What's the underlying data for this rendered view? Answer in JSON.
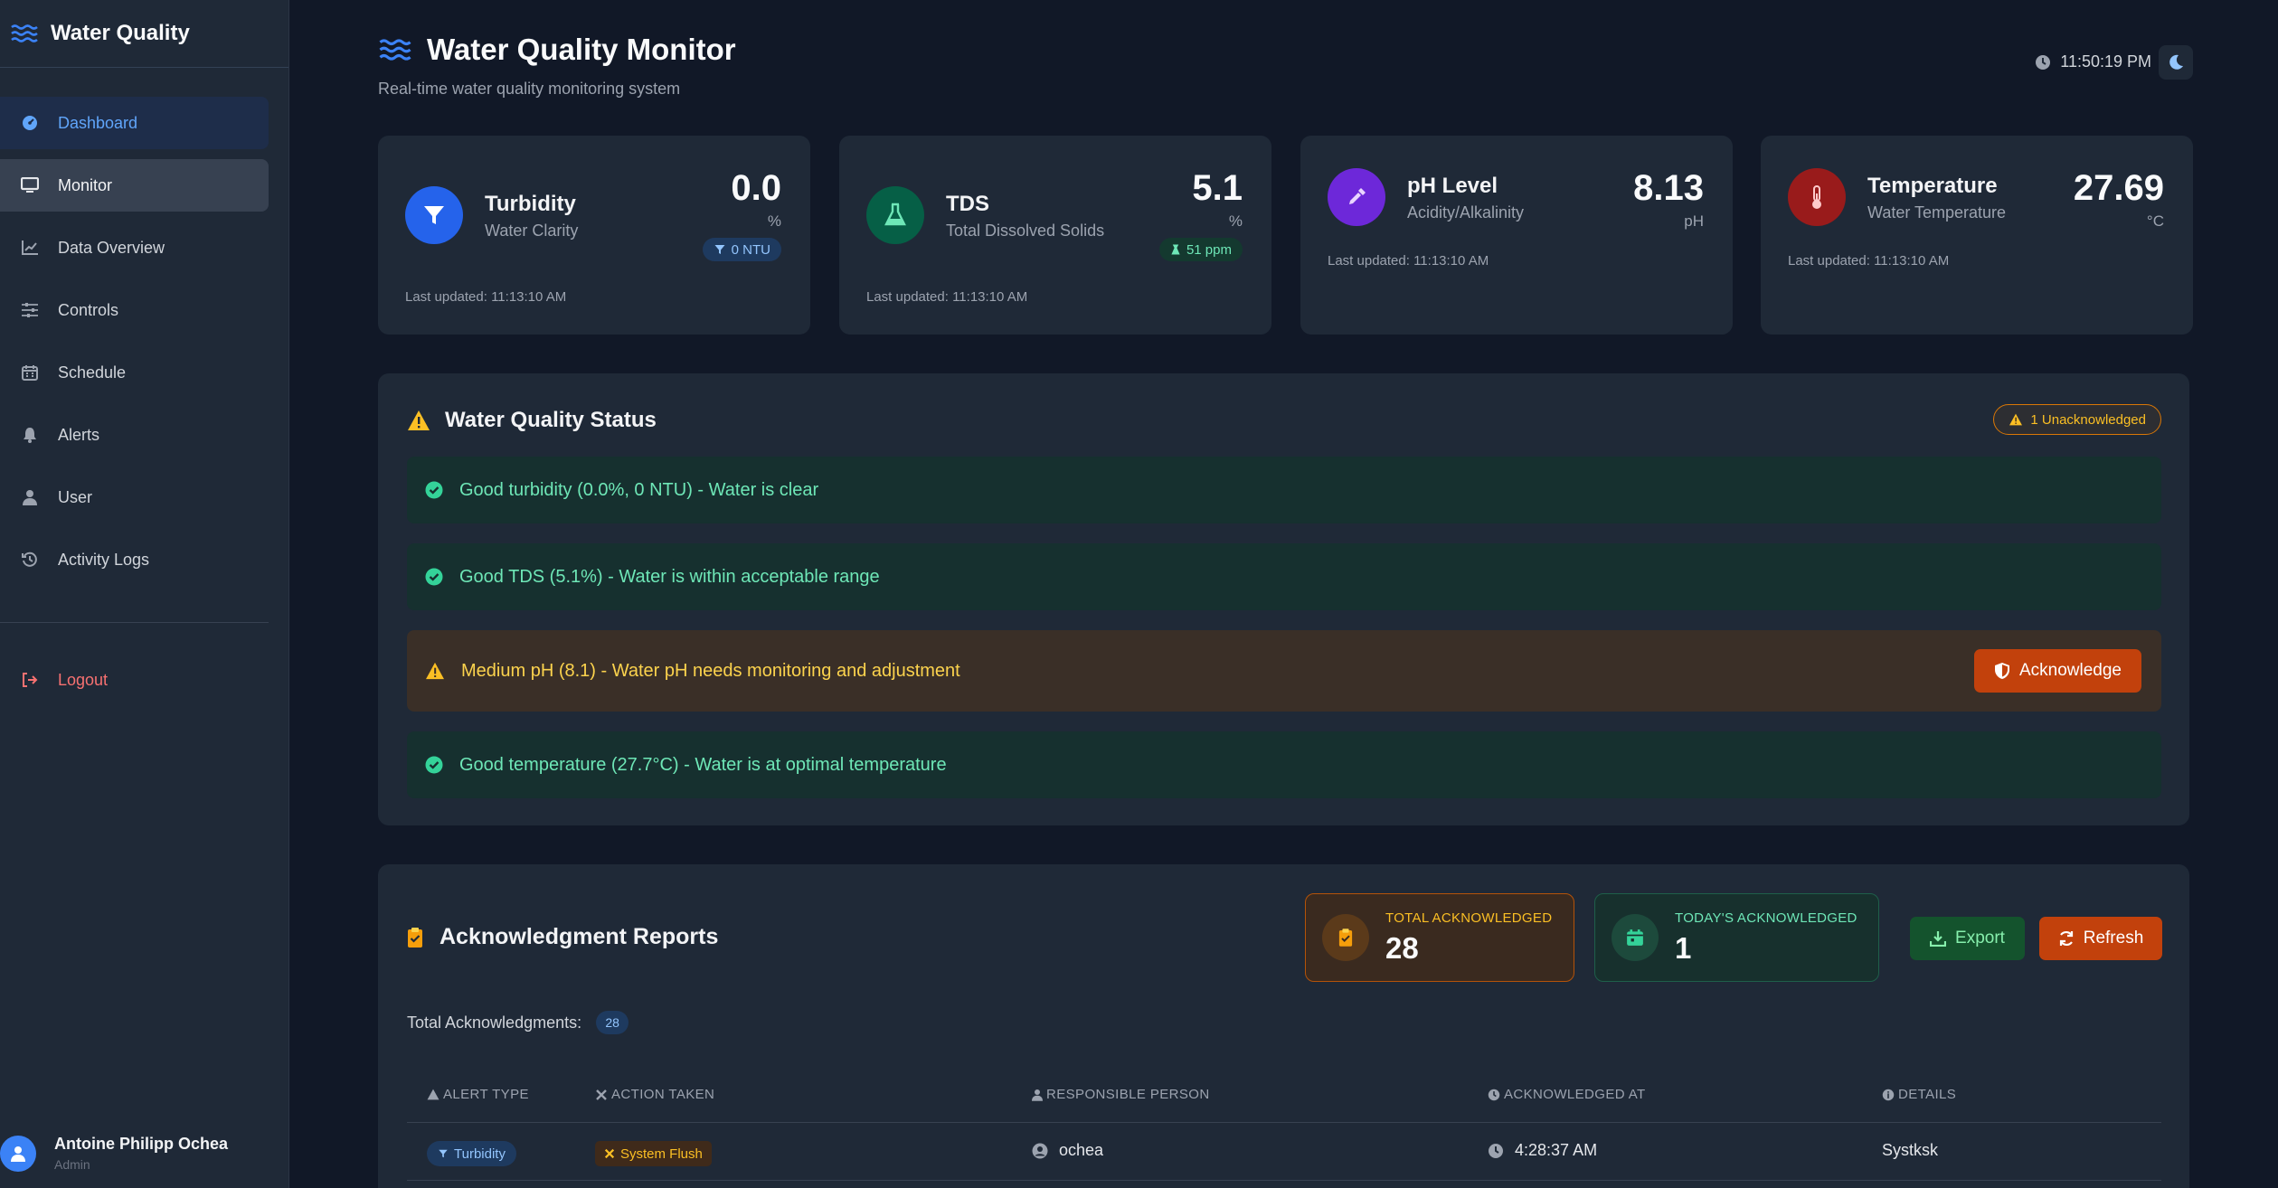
{
  "sidebar": {
    "brand": "Water Quality",
    "items": [
      {
        "label": "Dashboard",
        "icon": "dashboard-icon"
      },
      {
        "label": "Monitor",
        "icon": "monitor-icon"
      },
      {
        "label": "Data Overview",
        "icon": "chart-line-icon"
      },
      {
        "label": "Controls",
        "icon": "sliders-icon"
      },
      {
        "label": "Schedule",
        "icon": "calendar-icon"
      },
      {
        "label": "Alerts",
        "icon": "bell-icon"
      },
      {
        "label": "User",
        "icon": "user-icon"
      },
      {
        "label": "Activity Logs",
        "icon": "history-icon"
      }
    ],
    "logout": "Logout",
    "user": {
      "name": "Antoine Philipp Ochea",
      "role": "Admin"
    }
  },
  "header": {
    "title": "Water Quality Monitor",
    "subtitle": "Real-time water quality monitoring system",
    "time": "11:50:19 PM"
  },
  "cards": [
    {
      "name": "Turbidity",
      "sub": "Water Clarity",
      "value": "0.0",
      "unit": "%",
      "badge": "0 NTU",
      "updated": "Last updated: 11:13:10 AM",
      "color": "#2563eb"
    },
    {
      "name": "TDS",
      "sub": "Total Dissolved Solids",
      "value": "5.1",
      "unit": "%",
      "badge": "51 ppm",
      "updated": "Last updated: 11:13:10 AM",
      "color": "#065f46"
    },
    {
      "name": "pH Level",
      "sub": "Acidity/Alkalinity",
      "value": "8.13",
      "unit": "pH",
      "updated": "Last updated: 11:13:10 AM",
      "color": "#6d28d9"
    },
    {
      "name": "Temperature",
      "sub": "Water Temperature",
      "value": "27.69",
      "unit": "°C",
      "updated": "Last updated: 11:13:10 AM",
      "color": "#991b1b"
    }
  ],
  "status": {
    "title": "Water Quality Status",
    "unack_badge": "1 Unacknowledged",
    "rows": [
      {
        "text": "Good turbidity (0.0%, 0 NTU) - Water is clear",
        "level": "good"
      },
      {
        "text": "Good TDS (5.1%) - Water is within acceptable range",
        "level": "good"
      },
      {
        "text": "Medium pH (8.1) - Water pH needs monitoring and adjustment",
        "level": "warn"
      },
      {
        "text": "Good temperature (27.7°C) - Water is at optimal temperature",
        "level": "good"
      }
    ],
    "acknowledge_label": "Acknowledge"
  },
  "reports": {
    "title": "Acknowledgment Reports",
    "total_label": "TOTAL ACKNOWLEDGED",
    "total_value": "28",
    "today_label": "TODAY'S ACKNOWLEDGED",
    "today_value": "1",
    "export_label": "Export",
    "refresh_label": "Refresh",
    "total_ack_text": "Total Acknowledgments:",
    "total_ack_count": "28",
    "columns": [
      "ALERT TYPE",
      "ACTION TAKEN",
      "RESPONSIBLE PERSON",
      "ACKNOWLEDGED AT",
      "DETAILS"
    ],
    "rows": [
      {
        "alert_type": "Turbidity",
        "action": "System Flush",
        "person": "ochea",
        "at": "4:28:37 AM",
        "details": "Systksk"
      }
    ]
  }
}
